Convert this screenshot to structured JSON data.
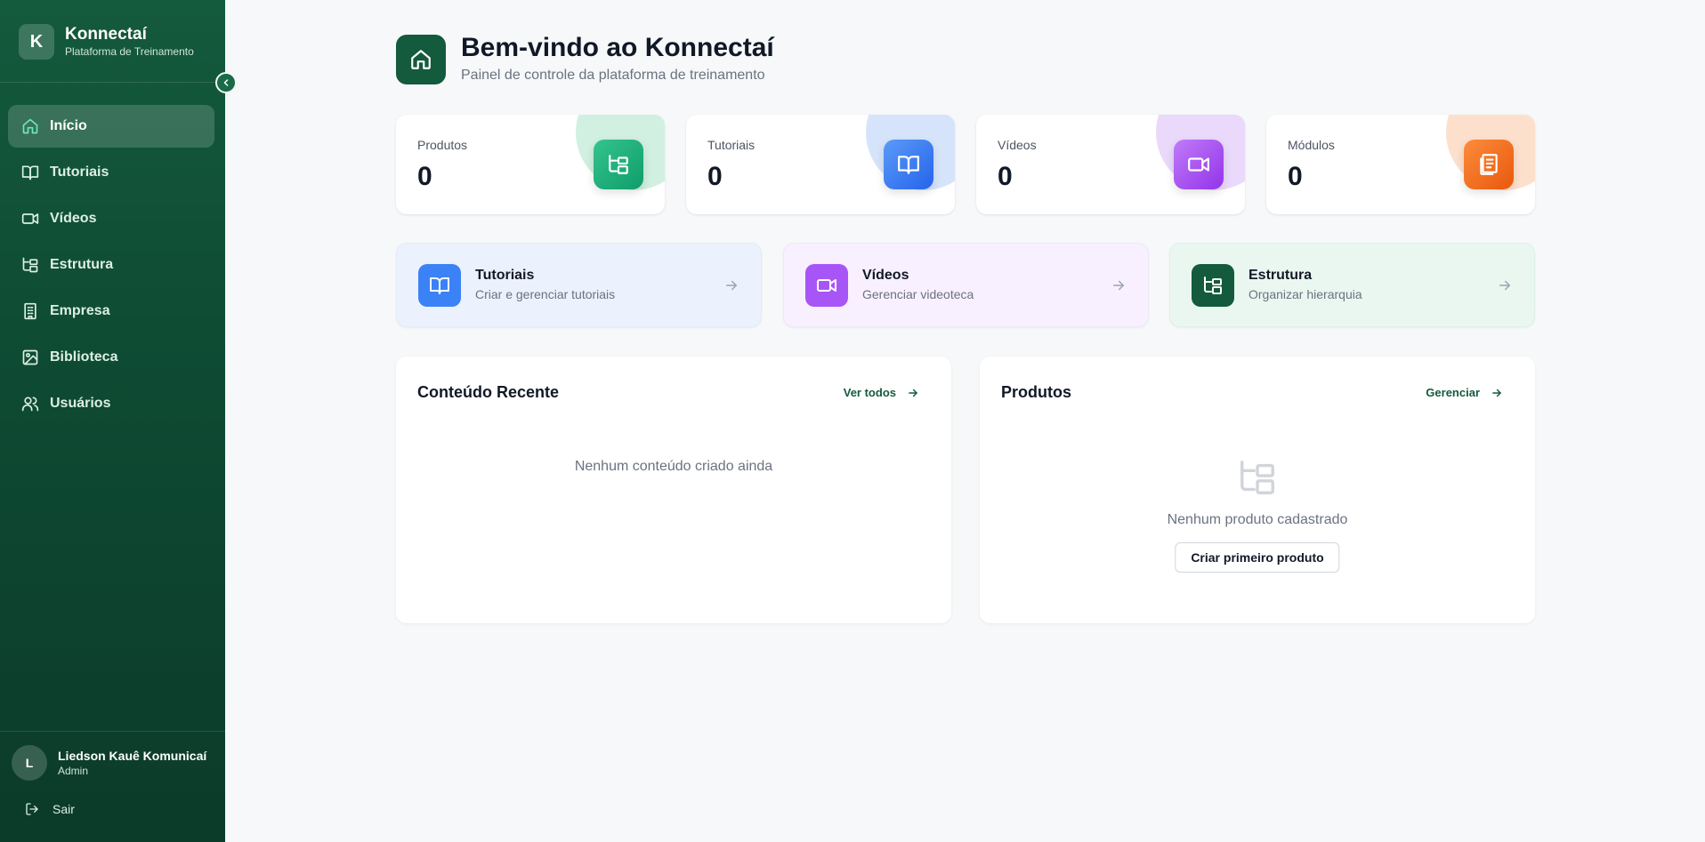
{
  "brand": {
    "logo_letter": "K",
    "name": "Konnectaí",
    "subtitle": "Plataforma de Treinamento"
  },
  "sidebar": {
    "items": [
      {
        "label": "Início",
        "icon": "home-icon",
        "active": true
      },
      {
        "label": "Tutoriais",
        "icon": "book-icon"
      },
      {
        "label": "Vídeos",
        "icon": "video-icon"
      },
      {
        "label": "Estrutura",
        "icon": "hierarchy-icon"
      },
      {
        "label": "Empresa",
        "icon": "building-icon"
      },
      {
        "label": "Biblioteca",
        "icon": "image-icon"
      },
      {
        "label": "Usuários",
        "icon": "users-icon"
      }
    ],
    "user": {
      "initial": "L",
      "name": "Liedson Kauê Komunicaí",
      "role": "Admin"
    },
    "logout_label": "Sair"
  },
  "header": {
    "title": "Bem-vindo ao Konnectaí",
    "subtitle": "Painel de controle da plataforma de treinamento"
  },
  "stats": [
    {
      "label": "Produtos",
      "value": "0",
      "icon": "hierarchy-icon",
      "color": "#10b981"
    },
    {
      "label": "Tutoriais",
      "value": "0",
      "icon": "book-icon",
      "color": "#3b82f6"
    },
    {
      "label": "Vídeos",
      "value": "0",
      "icon": "video-icon",
      "color": "#a855f7"
    },
    {
      "label": "Módulos",
      "value": "0",
      "icon": "document-icon",
      "color": "#f97316"
    }
  ],
  "quick_actions": [
    {
      "title": "Tutoriais",
      "subtitle": "Criar e gerenciar tutoriais",
      "icon": "book-icon",
      "color": "#3b82f6"
    },
    {
      "title": "Vídeos",
      "subtitle": "Gerenciar videoteca",
      "icon": "video-icon",
      "color": "#a855f7"
    },
    {
      "title": "Estrutura",
      "subtitle": "Organizar hierarquia",
      "icon": "hierarchy-icon",
      "color": "#145a3d"
    }
  ],
  "recent": {
    "title": "Conteúdo Recente",
    "link_label": "Ver todos",
    "empty_text": "Nenhum conteúdo criado ainda"
  },
  "products": {
    "title": "Produtos",
    "link_label": "Gerenciar",
    "empty_text": "Nenhum produto cadastrado",
    "create_label": "Criar primeiro produto"
  },
  "colors": {
    "sidebar": "#0e4a33",
    "accent": "#145a3d",
    "background": "#f6f8f9"
  }
}
